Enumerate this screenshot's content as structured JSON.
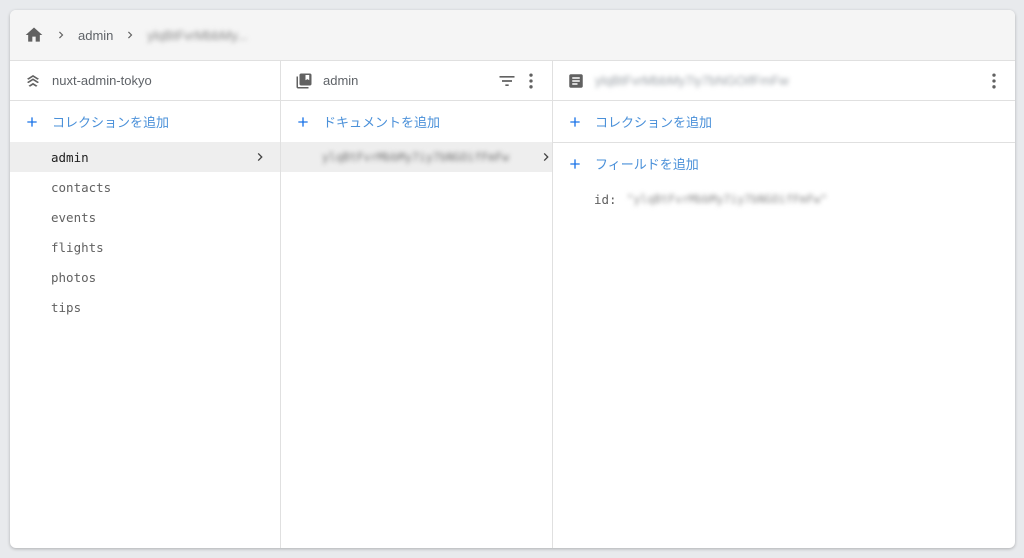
{
  "breadcrumb": {
    "items": [
      "admin",
      "ylqBtFvrMbbMy..."
    ]
  },
  "columns": {
    "project": {
      "title": "nuxt-admin-tokyo",
      "add_label": "コレクションを追加",
      "collections": [
        "admin",
        "contacts",
        "events",
        "flights",
        "photos",
        "tips"
      ],
      "selected": "admin"
    },
    "collection": {
      "title": "admin",
      "add_label": "ドキュメントを追加",
      "documents": [
        "ylqBtFvrMbbMy7iy7bNGOifFmFw"
      ]
    },
    "document": {
      "title": "ylqBtFvrMbbMy7iy7bNGOifFmFw",
      "add_collection_label": "コレクションを追加",
      "add_field_label": "フィールドを追加",
      "fields": [
        {
          "key": "id:",
          "value": "\"ylqBtFvrMbbMy7iy7bNGOifFmFw\""
        }
      ]
    }
  },
  "colors": {
    "accent": "#1a73e8",
    "selected_bg": "#eeeeee",
    "border": "#e0e0e0"
  },
  "icons": [
    "home-icon",
    "chevron-right-icon",
    "firestore-project-icon",
    "collection-icon",
    "filter-icon",
    "more-vert-icon",
    "document-icon",
    "plus-icon"
  ]
}
